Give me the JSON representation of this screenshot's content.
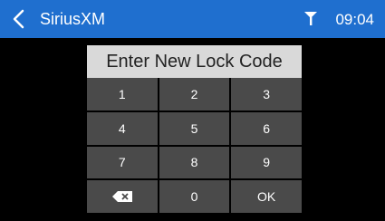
{
  "header": {
    "title": "SiriusXM",
    "time": "09:04",
    "back_icon": "chevron-left-icon",
    "signal_icon": "antenna-signal-icon",
    "color": "#1f6fcf"
  },
  "dialog": {
    "prompt": "Enter New Lock Code"
  },
  "keypad": {
    "keys": [
      "1",
      "2",
      "3",
      "4",
      "5",
      "6",
      "7",
      "8",
      "9",
      "",
      "0",
      "OK"
    ],
    "backspace_icon": "backspace-icon"
  }
}
